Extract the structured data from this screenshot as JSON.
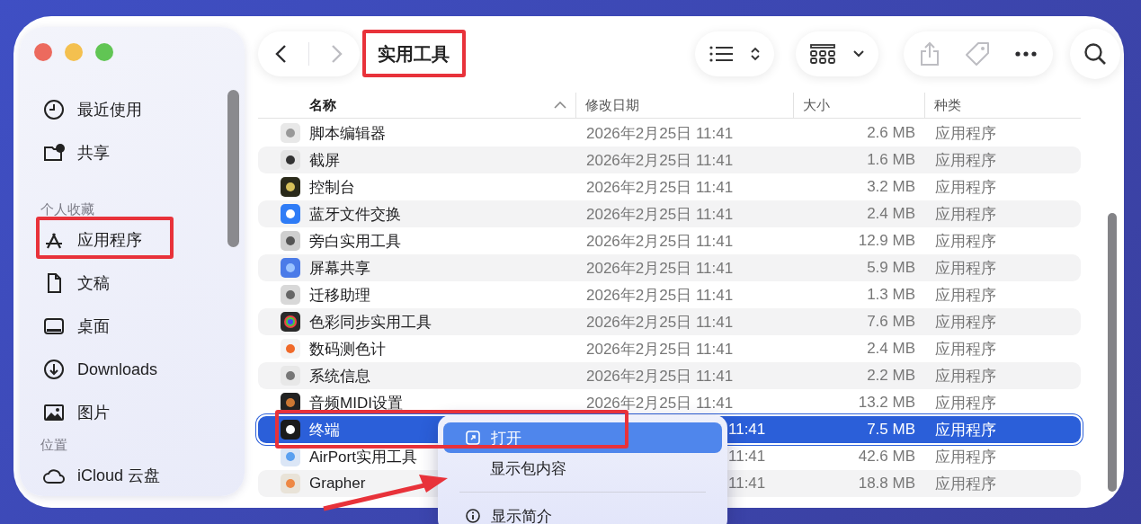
{
  "window": {
    "title": "实用工具"
  },
  "toolbar": {
    "back": {
      "disabled": false
    },
    "forward": {
      "disabled": true
    },
    "share": {
      "disabled": true
    },
    "tag": {
      "disabled": true
    },
    "more": {
      "disabled": false
    }
  },
  "sidebar": {
    "sections": [
      {
        "items": [
          {
            "label": "最近使用",
            "selected": false
          },
          {
            "label": "共享",
            "selected": false
          }
        ]
      },
      {
        "heading": "个人收藏",
        "items": [
          {
            "label": "应用程序",
            "selected": false
          },
          {
            "label": "文稿",
            "selected": false
          },
          {
            "label": "桌面",
            "selected": false
          },
          {
            "label": "Downloads",
            "selected": false
          },
          {
            "label": "图片",
            "selected": false
          }
        ]
      },
      {
        "heading": "位置",
        "items": [
          {
            "label": "iCloud 云盘",
            "selected": false
          }
        ]
      }
    ]
  },
  "table": {
    "columns": [
      {
        "label": "名称",
        "sorted": true
      },
      {
        "label": "修改日期",
        "sorted": false
      },
      {
        "label": "大小",
        "sorted": false
      },
      {
        "label": "种类",
        "sorted": false
      }
    ],
    "rows": [
      {
        "name": "脚本编辑器",
        "modified": "2026年2月25日 11:41",
        "size": "2.6 MB",
        "category": "应用程序",
        "selected": false
      },
      {
        "name": "截屏",
        "modified": "2026年2月25日 11:41",
        "size": "1.6 MB",
        "category": "应用程序",
        "selected": false
      },
      {
        "name": "控制台",
        "modified": "2026年2月25日 11:41",
        "size": "3.2 MB",
        "category": "应用程序",
        "selected": false
      },
      {
        "name": "蓝牙文件交换",
        "modified": "2026年2月25日 11:41",
        "size": "2.4 MB",
        "category": "应用程序",
        "selected": false
      },
      {
        "name": "旁白实用工具",
        "modified": "2026年2月25日 11:41",
        "size": "12.9 MB",
        "category": "应用程序",
        "selected": false
      },
      {
        "name": "屏幕共享",
        "modified": "2026年2月25日 11:41",
        "size": "5.9 MB",
        "category": "应用程序",
        "selected": false
      },
      {
        "name": "迁移助理",
        "modified": "2026年2月25日 11:41",
        "size": "1.3 MB",
        "category": "应用程序",
        "selected": false
      },
      {
        "name": "色彩同步实用工具",
        "modified": "2026年2月25日 11:41",
        "size": "7.6 MB",
        "category": "应用程序",
        "selected": false
      },
      {
        "name": "数码测色计",
        "modified": "2026年2月25日 11:41",
        "size": "2.4 MB",
        "category": "应用程序",
        "selected": false
      },
      {
        "name": "系统信息",
        "modified": "2026年2月25日 11:41",
        "size": "2.2 MB",
        "category": "应用程序",
        "selected": false
      },
      {
        "name": "音频MIDI设置",
        "modified": "2026年2月25日 11:41",
        "size": "13.2 MB",
        "category": "应用程序",
        "selected": false
      },
      {
        "name": "终端",
        "modified": "11:41",
        "size": "7.5 MB",
        "category": "应用程序",
        "selected": true
      },
      {
        "name": "AirPort实用工具",
        "modified": "11:41",
        "size": "42.6 MB",
        "category": "应用程序",
        "selected": false
      },
      {
        "name": "Grapher",
        "modified": "11:41",
        "size": "18.8 MB",
        "category": "应用程序",
        "selected": false
      }
    ]
  },
  "context_menu": {
    "items": [
      {
        "kind": "action",
        "label": "打开",
        "selected": true
      },
      {
        "kind": "action",
        "label": "显示包内容",
        "selected": false
      },
      {
        "kind": "separator"
      },
      {
        "kind": "action",
        "label": "显示简介",
        "selected": false
      }
    ]
  }
}
